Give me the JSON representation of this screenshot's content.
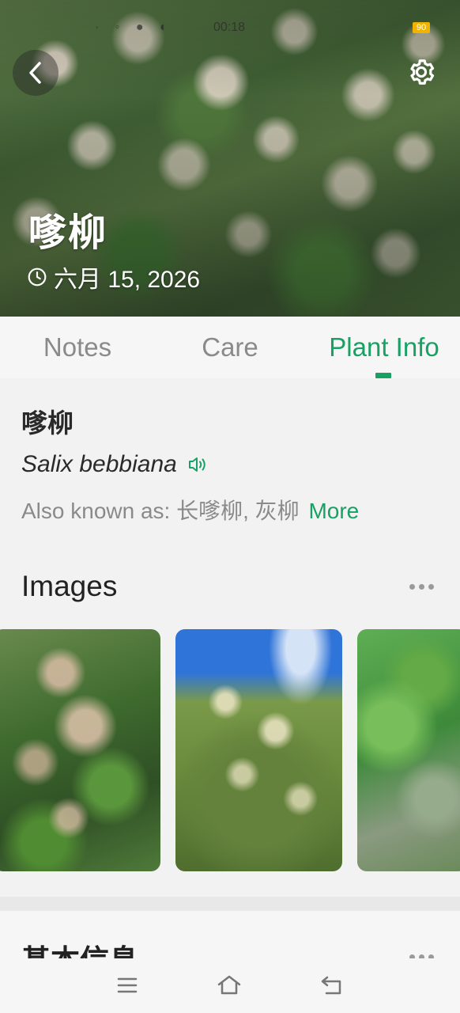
{
  "status_bar": {
    "time": "00:18",
    "battery": "90"
  },
  "header": {
    "title": "嗲柳",
    "date": "六月 15, 2026"
  },
  "tabs": [
    {
      "label": "Notes"
    },
    {
      "label": "Care"
    },
    {
      "label": "Plant Info",
      "active": true
    }
  ],
  "plant_info": {
    "name": "嗲柳",
    "latin_name": "Salix bebbiana",
    "aka_prefix": "Also known as: 长嗲柳, 灰柳",
    "more_label": "More"
  },
  "images_section": {
    "title": "Images",
    "image_count_visible": 3
  },
  "basic_info_section": {
    "title": "基本信息"
  },
  "colors": {
    "accent": "#17a164",
    "muted_text": "#8a8a8a",
    "background": "#f2f2f2"
  },
  "icons": {
    "back": "chevron-left-icon",
    "settings": "gear-icon",
    "date": "clock-icon",
    "pronounce": "speaker-icon",
    "more": "more-dots-icon",
    "nav_menu": "menu-icon",
    "nav_home": "home-icon",
    "nav_back": "back-icon"
  }
}
